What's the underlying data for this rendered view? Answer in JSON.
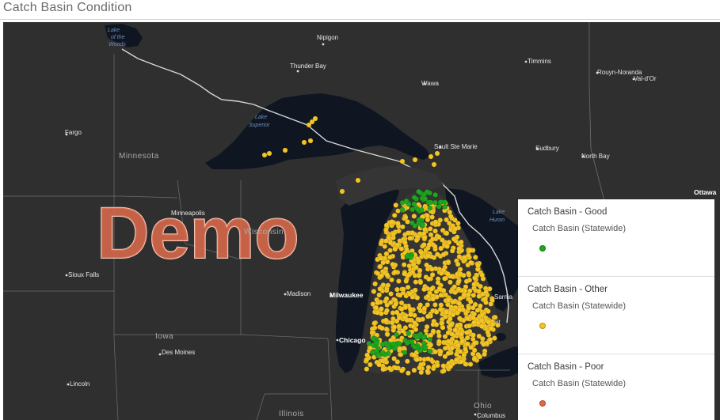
{
  "page": {
    "title": "Catch Basin Condition"
  },
  "map": {
    "watermark": "Demo",
    "labels": {
      "lake_of_the_woods_1": "Lake",
      "lake_of_the_woods_2": "of the",
      "lake_of_the_woods_3": "Woods",
      "nipigon": "Nipigon",
      "thunder_bay": "Thunder Bay",
      "wawa": "Wawa",
      "timmins": "Timmins",
      "rouyn_noranda": "Rouyn-Noranda",
      "val_dor": "Val-d'Or",
      "lake_superior_1": "Lake",
      "lake_superior_2": "Superior",
      "fargo": "Fargo",
      "sault_ste_marie": "Sault Ste Marie",
      "sudbury": "Sudbury",
      "north_bay": "North Bay",
      "minnesota": "Minnesota",
      "ottawa": "Ottawa",
      "minneapolis": "Minneapolis",
      "wisconsin": "Wisconsin",
      "lake_huron_1": "Lake",
      "lake_huron_2": "Huron",
      "sioux_falls": "Sioux Falls",
      "madison": "Madison",
      "milwaukee": "Milwaukee",
      "sarnia": "Sarnia",
      "detroit": "Detroit",
      "iowa": "Iowa",
      "des_moines": "Des Moines",
      "chicago": "Chicago",
      "lincoln": "Lincoln",
      "illinois": "Illinois",
      "ohio": "Ohio",
      "columbus": "Columbus"
    },
    "colors": {
      "land": "#2f2f2f",
      "water": "#0f1622",
      "border": "#8a8a8a",
      "good": "#1fa51f",
      "other": "#f2c424",
      "poor": "#e8643c"
    },
    "corner_glyph": "o"
  },
  "legend": {
    "groups": [
      {
        "title": "Catch Basin - Good",
        "layer": "Catch Basin (Statewide)",
        "color": "#1fa51f"
      },
      {
        "title": "Catch Basin - Other",
        "layer": "Catch Basin (Statewide)",
        "color": "#f2c424"
      },
      {
        "title": "Catch Basin - Poor",
        "layer": "Catch Basin (Statewide)",
        "color": "#e8643c"
      }
    ]
  }
}
